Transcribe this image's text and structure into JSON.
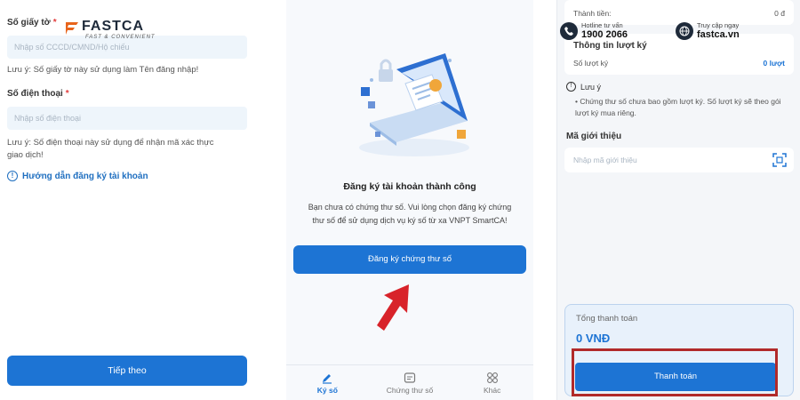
{
  "brand": {
    "name": "FASTCA",
    "tagline": "FAST & CONVENIENT"
  },
  "header": {
    "hotline_label": "Hotline tư vấn",
    "hotline_number": "1900 2066",
    "web_label": "Truy cập ngay",
    "web_url": "fastca.vn"
  },
  "screen1": {
    "id_label": "Số giấy tờ",
    "id_required": "*",
    "id_placeholder": "Nhập số CCCD/CMND/Hộ chiếu",
    "id_note": "Lưu ý: Số giấy tờ này sử dụng làm Tên đăng nhập!",
    "phone_label": "Số điện thoại",
    "phone_required": "*",
    "phone_placeholder": "Nhập số điện thoại",
    "phone_note_line1": "Lưu ý: Số điện thoại này sử dụng để nhận mã xác thực",
    "phone_note_line2": "giao dịch!",
    "guide_link": "Hướng dẫn đăng ký tài khoản",
    "next_button": "Tiếp theo"
  },
  "screen2": {
    "title": "Đăng ký tài khoản thành công",
    "desc_line1": "Bạn chưa có chứng thư số. Vui lòng chọn đăng ký chứng",
    "desc_line2": "thư số để sử dụng dịch vụ ký số từ xa VNPT SmartCA!",
    "register_button": "Đăng ký chứng thư số",
    "tabs": [
      {
        "label": "Ký số",
        "active": true
      },
      {
        "label": "Chứng thư số",
        "active": false
      },
      {
        "label": "Khác",
        "active": false
      }
    ]
  },
  "screen3": {
    "top_row_label": "Thành tiền:",
    "top_row_value": "0 đ",
    "sign_info_title": "Thông tin lượt ký",
    "sign_count_label": "Số lượt ký",
    "sign_count_value": "0 lượt",
    "note_title": "Lưu ý",
    "note_text": "Chứng thư số chưa bao gồm lượt ký. Số lượt ký sẽ theo gói lượt ký mua riêng.",
    "referral_title": "Mã giới thiệu",
    "referral_placeholder": "Nhập mã giới thiệu",
    "total_label": "Tổng thanh toán",
    "total_value": "0 VNĐ",
    "pay_button": "Thanh toán"
  },
  "colors": {
    "primary": "#1d74d4",
    "highlight_frame": "#b12a2a",
    "arrow": "#d8232a"
  }
}
